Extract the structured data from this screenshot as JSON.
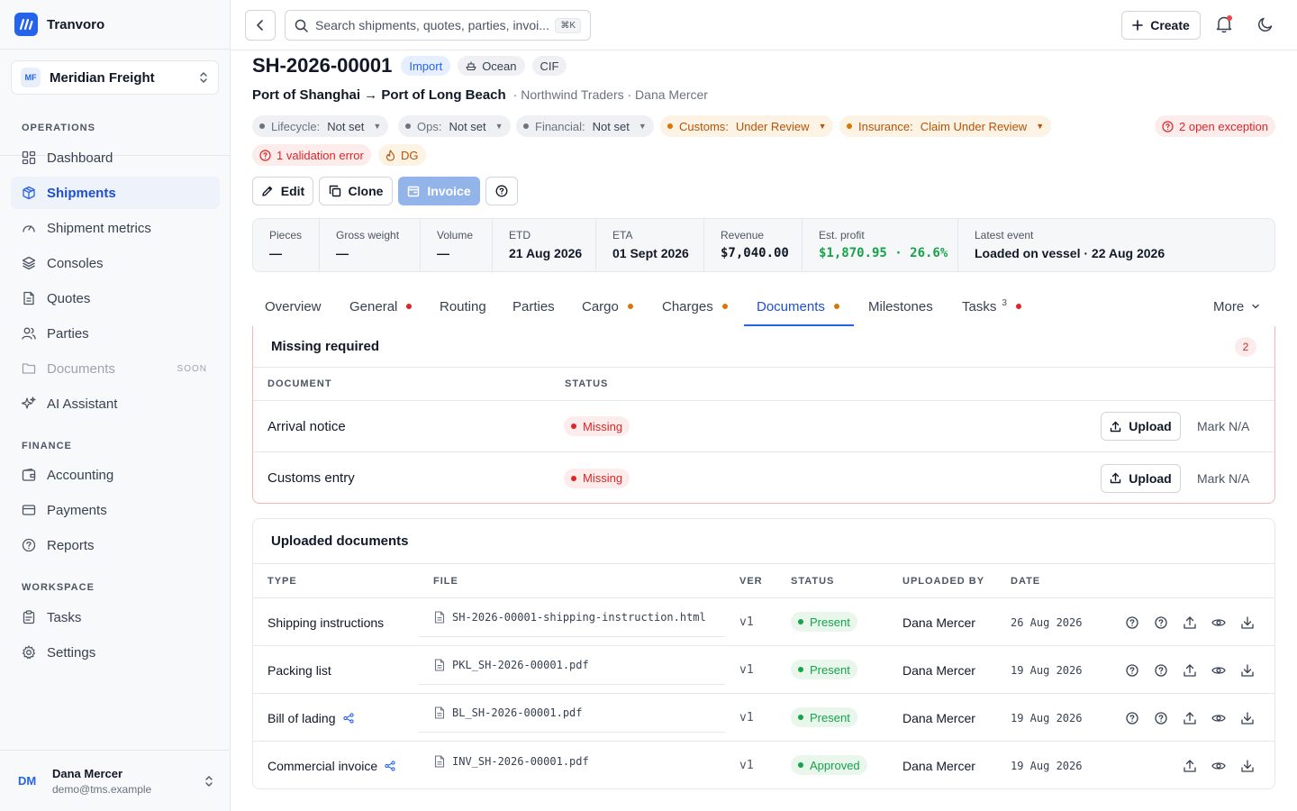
{
  "app": {
    "name": "Tranvoro"
  },
  "org": {
    "badge": "MF",
    "name": "Meridian Freight"
  },
  "sidebar": {
    "sections": {
      "operations": "OPERATIONS",
      "finance": "FINANCE",
      "workspace": "WORKSPACE"
    },
    "items": {
      "dashboard": "Dashboard",
      "shipments": "Shipments",
      "metrics": "Shipment metrics",
      "consoles": "Consoles",
      "quotes": "Quotes",
      "parties": "Parties",
      "documents": "Documents",
      "documents_badge": "SOON",
      "ai": "AI Assistant",
      "accounting": "Accounting",
      "payments": "Payments",
      "reports": "Reports",
      "tasks": "Tasks",
      "settings": "Settings"
    }
  },
  "user": {
    "initials": "DM",
    "name": "Dana Mercer",
    "email": "demo@tms.example"
  },
  "topbar": {
    "search_placeholder": "Search shipments, quotes, parties, invoi...",
    "shortcut": "⌘K",
    "create_label": "Create"
  },
  "shipment": {
    "id": "SH-2026-00001",
    "tags": {
      "direction": "Import",
      "mode": "Ocean",
      "incoterm": "CIF"
    },
    "route": "Port of Shanghai → Port of Long Beach",
    "sub": "· Northwind Traders · Dana Mercer",
    "statuses": {
      "lifecycle_label": "Lifecycle:",
      "lifecycle_value": "Not set",
      "ops_label": "Ops:",
      "ops_value": "Not set",
      "financial_label": "Financial:",
      "financial_value": "Not set",
      "customs_label": "Customs:",
      "customs_value": "Under Review",
      "insurance_label": "Insurance:",
      "insurance_value": "Claim Under Review",
      "exceptions": "2 open exception",
      "validation": "1 validation error",
      "dg": "DG"
    },
    "actions": {
      "edit": "Edit",
      "clone": "Clone",
      "invoice": "Invoice"
    },
    "kpis": {
      "pieces_label": "Pieces",
      "pieces_value": "—",
      "gross_label": "Gross weight",
      "gross_value": "—",
      "volume_label": "Volume",
      "volume_value": "—",
      "etd_label": "ETD",
      "etd_value": "21 Aug 2026",
      "eta_label": "ETA",
      "eta_value": "01 Sept 2026",
      "revenue_label": "Revenue",
      "revenue_value": "$7,040.00",
      "profit_label": "Est. profit",
      "profit_value": "$1,870.95 · 26.6%",
      "event_label": "Latest event",
      "event_value": "Loaded on vessel · 22 Aug 2026"
    }
  },
  "tabs": {
    "overview": "Overview",
    "general": "General",
    "routing": "Routing",
    "parties": "Parties",
    "cargo": "Cargo",
    "charges": "Charges",
    "documents": "Documents",
    "milestones": "Milestones",
    "tasks": "Tasks",
    "tasks_count": "3",
    "more": "More"
  },
  "colors": {
    "accent": "#2563eb",
    "danger": "#dc2626",
    "warning": "#d97706",
    "success": "#16a34a"
  },
  "missing": {
    "title": "Missing required",
    "count": "2",
    "headers": {
      "document": "DOCUMENT",
      "status": "STATUS"
    },
    "rows": [
      {
        "document": "Arrival notice",
        "status": "Missing",
        "upload": "Upload",
        "mark": "Mark N/A"
      },
      {
        "document": "Customs entry",
        "status": "Missing",
        "upload": "Upload",
        "mark": "Mark N/A"
      }
    ]
  },
  "uploaded": {
    "title": "Uploaded documents",
    "headers": {
      "type": "TYPE",
      "file": "FILE",
      "ver": "VER",
      "status": "STATUS",
      "by": "UPLOADED BY",
      "date": "DATE"
    },
    "rows": [
      {
        "type": "Shipping instructions",
        "file": "SH-2026-00001-shipping-instruction.html",
        "ver": "v1",
        "status": "Present",
        "by": "Dana Mercer",
        "date": "26 Aug 2026"
      },
      {
        "type": "Packing list",
        "file": "PKL_SH-2026-00001.pdf",
        "ver": "v1",
        "status": "Present",
        "by": "Dana Mercer",
        "date": "19 Aug 2026"
      },
      {
        "type": "Bill of lading",
        "file": "BL_SH-2026-00001.pdf",
        "ver": "v1",
        "status": "Present",
        "by": "Dana Mercer",
        "date": "19 Aug 2026"
      },
      {
        "type": "Commercial invoice",
        "file": "INV_SH-2026-00001.pdf",
        "ver": "v1",
        "status": "Approved",
        "by": "Dana Mercer",
        "date": "19 Aug 2026"
      }
    ]
  }
}
